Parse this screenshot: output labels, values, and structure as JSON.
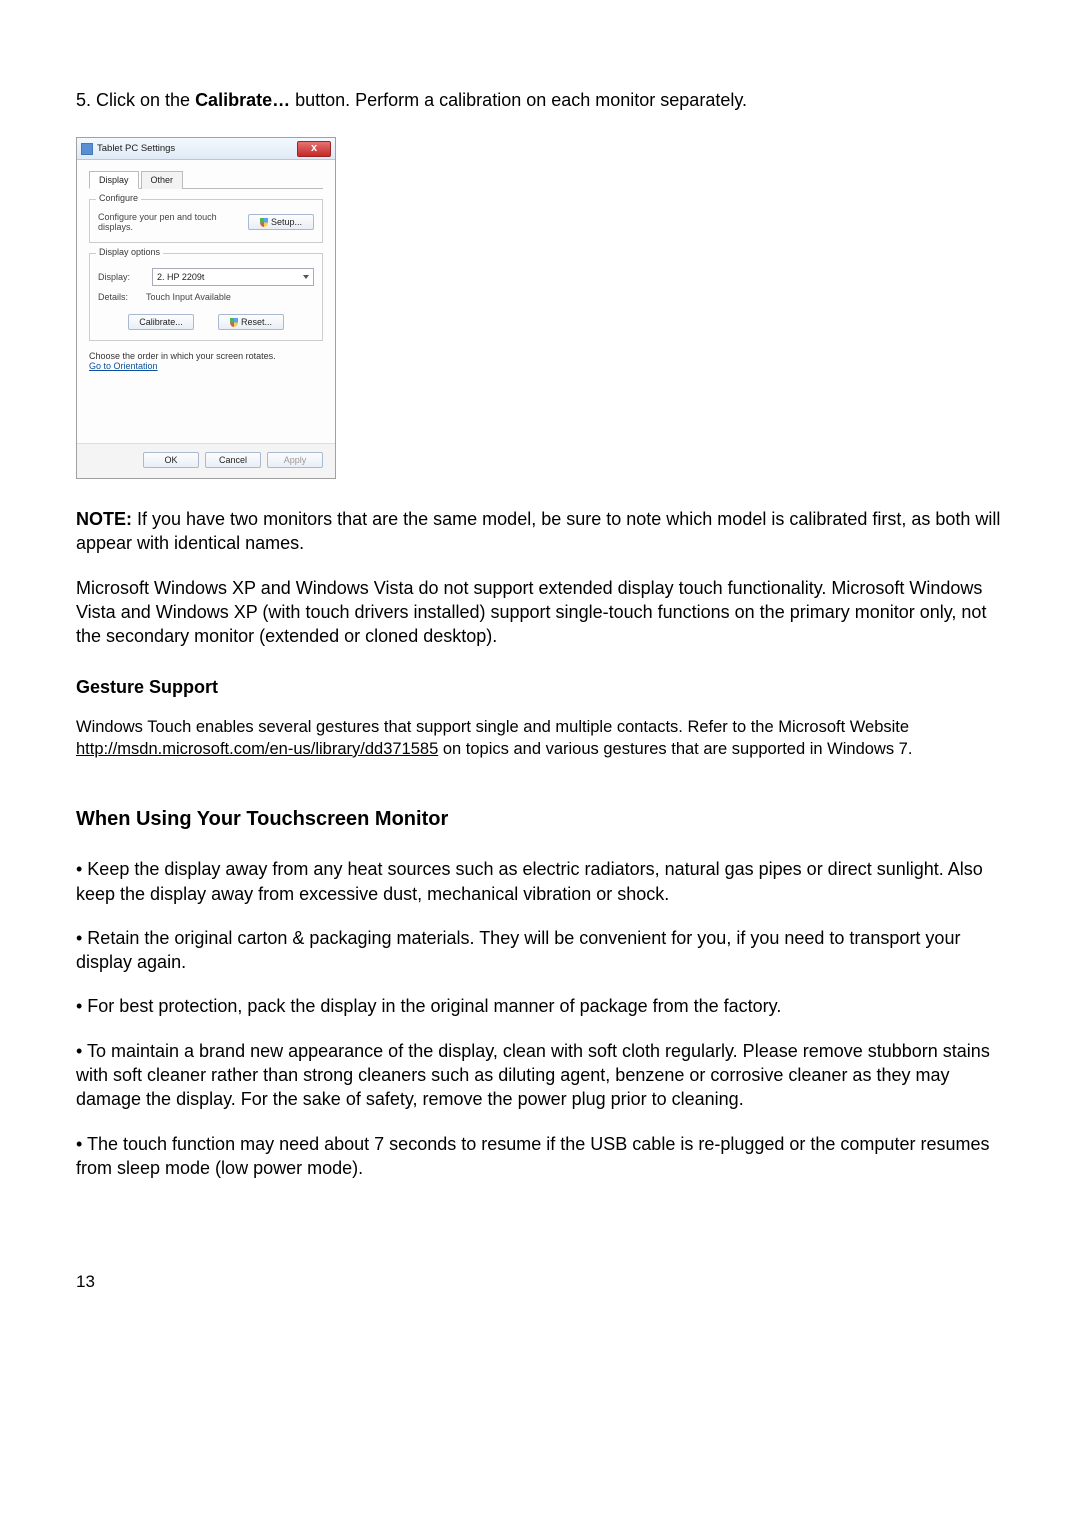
{
  "instruction": {
    "prefix": "5. Click on the ",
    "bold": "Calibrate…",
    "mid": " button.    Perform a calibration on each monitor separately."
  },
  "dialog": {
    "title": "Tablet PC Settings",
    "close": "x",
    "tabs": {
      "display": "Display",
      "other": "Other"
    },
    "configure": {
      "legend": "Configure",
      "text": "Configure your pen and touch displays.",
      "setup": "Setup..."
    },
    "display_options": {
      "legend": "Display options",
      "display_label": "Display:",
      "display_value": "2. HP 2209t",
      "details_label": "Details:",
      "details_value": "Touch Input Available",
      "calibrate": "Calibrate...",
      "reset": "Reset..."
    },
    "orientation": {
      "text": "Choose the order in which your screen rotates.",
      "link": "Go to Orientation"
    },
    "buttons": {
      "ok": "OK",
      "cancel": "Cancel",
      "apply": "Apply"
    }
  },
  "note": {
    "label": "NOTE:",
    "text": " If you have two monitors that are the same model, be sure to note which model is calibrated first, as both will appear with identical names."
  },
  "xp_vista": "Microsoft Windows XP and Windows Vista do not support extended display touch functionality. Microsoft Windows Vista and Windows XP (with touch drivers installed) support single-touch functions on the primary monitor only, not the secondary monitor (extended or cloned desktop).",
  "gesture": {
    "heading": "Gesture Support",
    "p1a": "Windows Touch enables several gestures that support single and multiple contacts. Refer to the Microsoft Website ",
    "link": "http://msdn.microsoft.com/en-us/library/dd371585",
    "p1b": " on topics and various gestures that are supported in Windows 7."
  },
  "using": {
    "heading": "When Using Your Touchscreen Monitor",
    "b1": "• Keep the display away from any heat sources such as electric radiators, natural gas pipes or direct sunlight. Also keep the display away from excessive dust, mechanical vibration or shock.",
    "b2": "• Retain the original carton & packaging materials. They will be convenient for you, if you need to transport your display again.",
    "b3": "• For best protection, pack the display in the original manner of package from the factory.",
    "b4": "• To maintain a brand new appearance of the display, clean with soft cloth regularly. Please remove stubborn stains with soft cleaner rather than strong cleaners such as diluting agent, benzene or corrosive cleaner as they may damage the display. For the sake of safety, remove the power plug prior to cleaning.",
    "b5": "• The touch function may need about 7 seconds to resume if the USB cable is re-plugged or the computer resumes from sleep mode (low power mode)."
  },
  "pagenum": "13"
}
